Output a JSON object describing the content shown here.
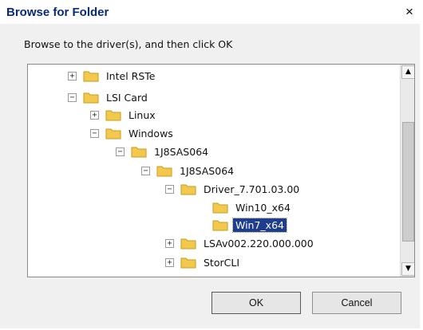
{
  "dialog": {
    "title": "Browse for Folder",
    "close_label": "×",
    "instruction": "Browse to the driver(s), and then click OK"
  },
  "tree": {
    "items": [
      {
        "label": "Intel RSTe",
        "expander": "+"
      },
      {
        "label": "LSI Card",
        "expander": "−"
      },
      {
        "label": "Linux",
        "expander": "+"
      },
      {
        "label": "Windows",
        "expander": "−"
      },
      {
        "label": "1J8SAS064",
        "expander": "−"
      },
      {
        "label": "1J8SAS064",
        "expander": "−"
      },
      {
        "label": "Driver_7.701.03.00",
        "expander": "−"
      },
      {
        "label": "Win10_x64",
        "expander": ""
      },
      {
        "label": "Win7_x64",
        "expander": "",
        "selected": true
      },
      {
        "label": "LSAv002.220.000.000",
        "expander": "+"
      },
      {
        "label": "StorCLI",
        "expander": "+"
      }
    ],
    "scroll_up": "▲",
    "scroll_down": "▼"
  },
  "buttons": {
    "ok": "OK",
    "cancel": "Cancel"
  },
  "colors": {
    "selection": "#1f3d8f",
    "folder": "#f2c94c"
  }
}
